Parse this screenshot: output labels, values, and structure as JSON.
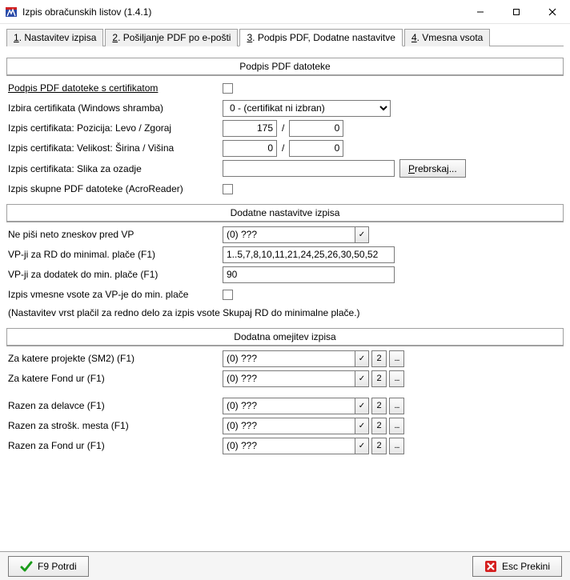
{
  "window": {
    "title": "Izpis obračunskih listov  (1.4.1)"
  },
  "tabs": {
    "t1_num": "1",
    "t1_rest": ". Nastavitev izpisa",
    "t2_num": "2",
    "t2_rest": ". Pošiljanje PDF po e-pošti",
    "t3_num": "3",
    "t3_rest": ". Podpis PDF,  Dodatne nastavitve",
    "t4_num": "4",
    "t4_rest": ". Vmesna vsota"
  },
  "group1": {
    "title": "Podpis PDF datoteke"
  },
  "sign": {
    "cert_label": "Podpis PDF datoteke s certifikatom",
    "cert_select_label": "Izbira certifikata (Windows shramba)",
    "cert_select_value": "0 - (certifikat ni izbran)",
    "pos_label": "Izpis certifikata: Pozicija: Levo / Zgoraj",
    "pos_left": "175",
    "pos_top": "0",
    "size_label": "Izpis certifikata: Velikost: Širina / Višina",
    "size_w": "0",
    "size_h": "0",
    "bg_label": "Izpis certifikata: Slika za ozadje",
    "bg_value": "",
    "browse_btn": "Prebrskaj...",
    "acro_label": "Izpis skupne PDF datoteke (AcroReader)"
  },
  "group2": {
    "title": "Dodatne nastavitve izpisa"
  },
  "extra": {
    "neto_label": "Ne piši neto zneskov pred VP",
    "neto_value": "(0) ???",
    "vp_rd_label": "VP-ji za RD do minimal. plače (F1)",
    "vp_rd_value": "1..5,7,8,10,11,21,24,25,26,30,50,52",
    "vp_add_label": "VP-ji za dodatek do min. plače (F1)",
    "vp_add_value": "90",
    "vmes_label": "Izpis vmesne vsote za VP-je do min. plače",
    "note": "(Nastavitev vrst plačil za redno delo za izpis vsote Skupaj RD do minimalne plače.)"
  },
  "group3": {
    "title": "Dodatna omejitev izpisa"
  },
  "limit": {
    "proj_label": "Za katere projekte (SM2) (F1)",
    "proj_value": "(0) ???",
    "fond1_label": "Za katere Fond ur (F1)",
    "fond1_value": "(0) ???",
    "delavce_label": "Razen za delavce (F1)",
    "delavce_value": "(0) ???",
    "strosk_label": "Razen za strošk. mesta (F1)",
    "strosk_value": "(0) ???",
    "fond2_label": "Razen za Fond ur (F1)",
    "fond2_value": "(0) ???",
    "two": "2",
    "dots": "..."
  },
  "footer": {
    "ok": "F9 Potrdi",
    "cancel": "Esc Prekini"
  }
}
